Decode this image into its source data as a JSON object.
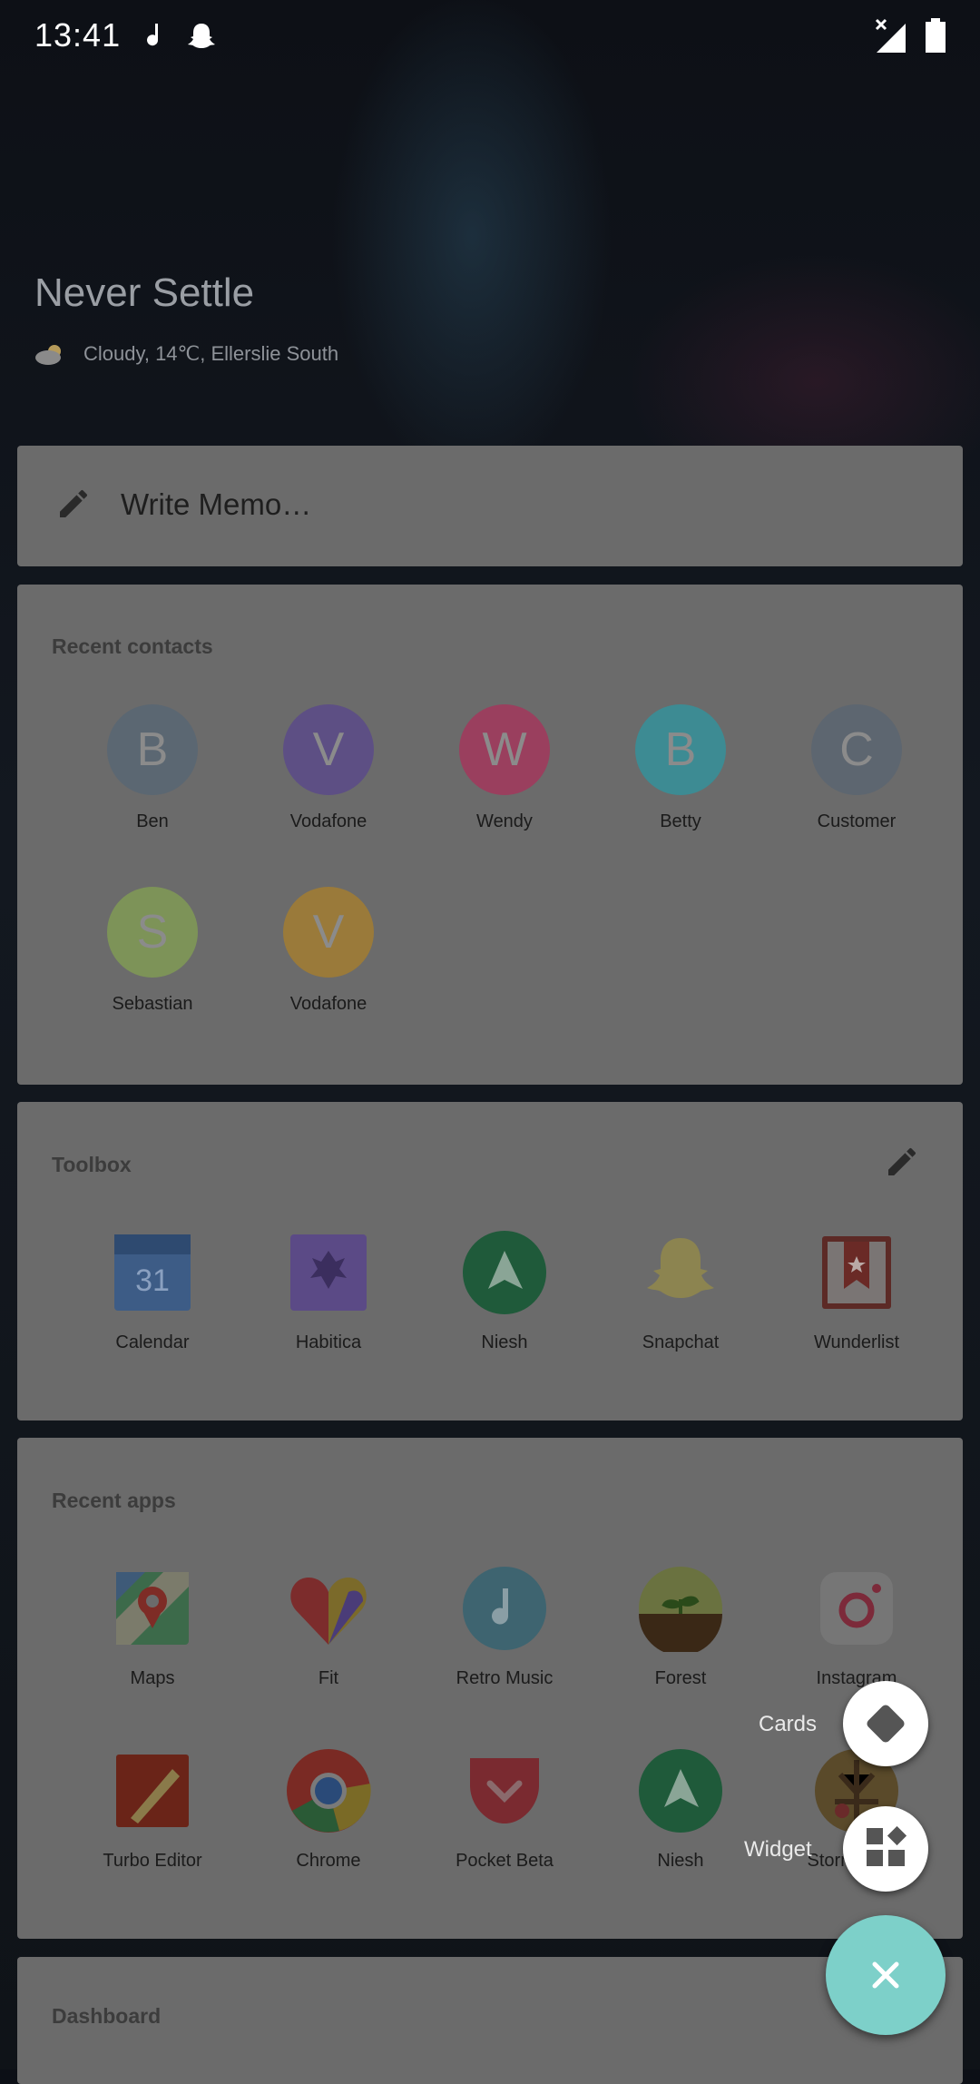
{
  "status_bar": {
    "time": "13:41"
  },
  "hero": {
    "title": "Never Settle",
    "weather": "Cloudy, 14℃, Ellerslie South"
  },
  "memo": {
    "placeholder": "Write Memo…"
  },
  "recent_contacts": {
    "title": "Recent contacts",
    "items": [
      {
        "initial": "B",
        "name": "Ben",
        "color": "#5b6772"
      },
      {
        "initial": "V",
        "name": "Vodafone",
        "color": "#5d4f84"
      },
      {
        "initial": "W",
        "name": "Wendy",
        "color": "#9a3f5e"
      },
      {
        "initial": "B",
        "name": "Betty",
        "color": "#3d8b93"
      },
      {
        "initial": "C",
        "name": "Customer",
        "color": "#5d6670"
      },
      {
        "initial": "S",
        "name": "Sebastian",
        "color": "#7d9358"
      },
      {
        "initial": "V",
        "name": "Vodafone",
        "color": "#9a7a3a"
      }
    ]
  },
  "toolbox": {
    "title": "Toolbox",
    "items": [
      {
        "name": "Calendar",
        "icon": "calendar-icon",
        "day": "31"
      },
      {
        "name": "Habitica",
        "icon": "habitica-icon"
      },
      {
        "name": "Niesh",
        "icon": "niesh-icon"
      },
      {
        "name": "Snapchat",
        "icon": "snapchat-icon"
      },
      {
        "name": "Wunderlist",
        "icon": "wunderlist-icon"
      }
    ]
  },
  "recent_apps": {
    "title": "Recent apps",
    "items": [
      {
        "name": "Maps",
        "icon": "maps-icon"
      },
      {
        "name": "Fit",
        "icon": "fit-icon"
      },
      {
        "name": "Retro Music",
        "icon": "retro-music-icon"
      },
      {
        "name": "Forest",
        "icon": "forest-icon"
      },
      {
        "name": "Instagram",
        "icon": "instagram-icon"
      },
      {
        "name": "Turbo Editor",
        "icon": "turbo-editor-icon"
      },
      {
        "name": "Chrome",
        "icon": "chrome-icon"
      },
      {
        "name": "Pocket Beta",
        "icon": "pocket-icon"
      },
      {
        "name": "Niesh",
        "icon": "niesh-icon"
      },
      {
        "name": "Stormbound",
        "icon": "stormbound-icon"
      }
    ]
  },
  "dashboard": {
    "title": "Dashboard"
  },
  "fab_menu": {
    "cards_label": "Cards",
    "widget_label": "Widget"
  },
  "colors": {
    "fab": "#7dd0c9",
    "card": "#6b6b6b",
    "scrim": "rgba(0,0,0,0.58)"
  }
}
